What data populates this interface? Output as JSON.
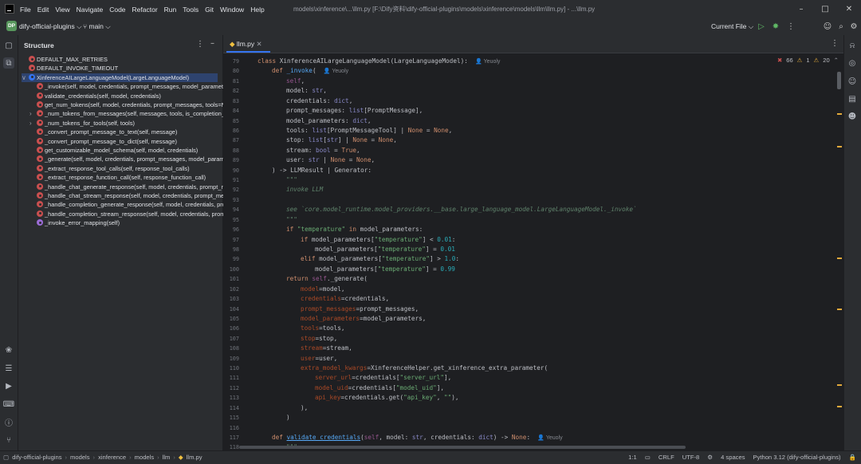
{
  "menu": [
    "File",
    "Edit",
    "View",
    "Navigate",
    "Code",
    "Refactor",
    "Run",
    "Tools",
    "Git",
    "Window",
    "Help"
  ],
  "window_title": "models\\xinference\\...\\llm.py [F:\\Dify资料\\dify-official-plugins\\models\\xinference\\models\\llm\\llm.py] - ...\\llm.py",
  "project": {
    "badge": "DP",
    "name": "dify-official-plugins",
    "branch": "main"
  },
  "run_config": "Current File",
  "structure": {
    "title": "Structure",
    "items": [
      {
        "label": "DEFAULT_MAX_RETRIES",
        "icon": "field-icon",
        "indent": 0
      },
      {
        "label": "DEFAULT_INVOKE_TIMEOUT",
        "icon": "field-icon",
        "indent": 0
      },
      {
        "label": "XinferenceAILargeLanguageModel(LargeLanguageModel)",
        "icon": "class-icon",
        "indent": 0,
        "selected": true,
        "expanded": true
      },
      {
        "label": "_invoke(self, model, credentials, prompt_messages, model_paramete",
        "icon": "method-icon",
        "indent": 1
      },
      {
        "label": "validate_credentials(self, model, credentials)",
        "icon": "method-icon",
        "indent": 1
      },
      {
        "label": "get_num_tokens(self, model, credentials, prompt_messages, tools=N",
        "icon": "method-icon",
        "indent": 1
      },
      {
        "label": "_num_tokens_from_messages(self, messages, tools, is_completion_m",
        "icon": "method-icon",
        "indent": 1,
        "collapsed": true
      },
      {
        "label": "_num_tokens_for_tools(self, tools)",
        "icon": "method-icon",
        "indent": 1,
        "collapsed": true
      },
      {
        "label": "_convert_prompt_message_to_text(self, message)",
        "icon": "method-icon",
        "indent": 1
      },
      {
        "label": "_convert_prompt_message_to_dict(self, message)",
        "icon": "method-icon",
        "indent": 1
      },
      {
        "label": "get_customizable_model_schema(self, model, credentials)",
        "icon": "method-icon",
        "indent": 1
      },
      {
        "label": "_generate(self, model, credentials, prompt_messages, model_param",
        "icon": "method-icon",
        "indent": 1
      },
      {
        "label": "_extract_response_tool_calls(self, response_tool_calls)",
        "icon": "method-icon",
        "indent": 1
      },
      {
        "label": "_extract_response_function_call(self, response_function_call)",
        "icon": "method-icon",
        "indent": 1
      },
      {
        "label": "_handle_chat_generate_response(self, model, credentials, prompt_m",
        "icon": "method-icon",
        "indent": 1
      },
      {
        "label": "_handle_chat_stream_response(self, model, credentials, prompt_mes",
        "icon": "method-icon",
        "indent": 1
      },
      {
        "label": "_handle_completion_generate_response(self, model, credentials, pro",
        "icon": "method-icon",
        "indent": 1
      },
      {
        "label": "_handle_completion_stream_response(self, model, credentials, prom",
        "icon": "method-icon",
        "indent": 1
      },
      {
        "label": "_invoke_error_mapping(self)",
        "icon": "property-icon",
        "indent": 1
      }
    ]
  },
  "editor": {
    "tab": "llm.py",
    "inspections": {
      "errors": "66",
      "warnings": "1",
      "weak": "20"
    },
    "hint_author": "Yeuoly",
    "lines": [
      {
        "n": "79",
        "html": "<span class='k'>class</span> XinferenceAILargeLanguageModel(LargeLanguageModel):  <span class='hint'>&#x1F464; Yeuoly</span>",
        "indent": 0
      },
      {
        "n": "80",
        "html": "<span class='k'>def</span> <span class='fn'>_invoke</span>(  <span class='hint'>&#x1F464; Yeuoly</span>",
        "indent": 1
      },
      {
        "n": "81",
        "html": "<span class='self'>self</span>,",
        "indent": 2
      },
      {
        "n": "82",
        "html": "model: <span class='bl'>str</span>,",
        "indent": 2
      },
      {
        "n": "83",
        "html": "credentials: <span class='bl'>dict</span>,",
        "indent": 2
      },
      {
        "n": "84",
        "html": "prompt_messages: <span class='bl'>list</span>[PromptMessage],",
        "indent": 2
      },
      {
        "n": "85",
        "html": "model_parameters: <span class='bl'>dict</span>,",
        "indent": 2
      },
      {
        "n": "86",
        "html": "tools: <span class='bl'>list</span>[PromptMessageTool] | <span class='k'>None</span> = <span class='k'>None</span>,",
        "indent": 2
      },
      {
        "n": "87",
        "html": "stop: <span class='bl'>list</span>[<span class='bl'>str</span>] | <span class='k'>None</span> = <span class='k'>None</span>,",
        "indent": 2
      },
      {
        "n": "88",
        "html": "stream: <span class='bl'>bool</span> = <span class='k'>True</span>,",
        "indent": 2
      },
      {
        "n": "89",
        "html": "user: <span class='bl'>str</span> | <span class='k'>None</span> = <span class='k'>None</span>,",
        "indent": 2
      },
      {
        "n": "90",
        "html": ") -&gt; LLMResult | Generator:",
        "indent": 1
      },
      {
        "n": "91",
        "html": "<span class='doc'>\"\"\"</span>",
        "indent": 2
      },
      {
        "n": "92",
        "html": "<span class='doc'>invoke LLM</span>",
        "indent": 2
      },
      {
        "n": "93",
        "html": "",
        "indent": 2
      },
      {
        "n": "94",
        "html": "<span class='doc'>see `core.model_runtime.model_providers.__base.large_language_model.LargeLanguageModel._invoke`</span>",
        "indent": 2
      },
      {
        "n": "95",
        "html": "<span class='doc'>\"\"\"</span>",
        "indent": 2
      },
      {
        "n": "96",
        "html": "<span class='k'>if</span> <span class='str'>\"temperature\"</span> <span class='k'>in</span> model_parameters:",
        "indent": 2
      },
      {
        "n": "97",
        "html": "<span class='k'>if</span> model_parameters[<span class='str'>\"temperature\"</span>] &lt; <span class='num'>0.01</span>:",
        "indent": 3
      },
      {
        "n": "98",
        "html": "model_parameters[<span class='str'>\"temperature\"</span>] = <span class='num'>0.01</span>",
        "indent": 4
      },
      {
        "n": "99",
        "html": "<span class='k'>elif</span> model_parameters[<span class='str'>\"temperature\"</span>] &gt; <span class='num'>1.0</span>:",
        "indent": 3
      },
      {
        "n": "100",
        "html": "model_parameters[<span class='str'>\"temperature\"</span>] = <span class='num'>0.99</span>",
        "indent": 4
      },
      {
        "n": "101",
        "html": "<span class='k'>return</span> <span class='self'>self</span>._generate(",
        "indent": 2
      },
      {
        "n": "102",
        "html": "<span class='kw'>model</span>=model,",
        "indent": 3
      },
      {
        "n": "103",
        "html": "<span class='kw'>credentials</span>=credentials,",
        "indent": 3
      },
      {
        "n": "104",
        "html": "<span class='kw'>prompt_messages</span>=prompt_messages,",
        "indent": 3
      },
      {
        "n": "105",
        "html": "<span class='kw'>model_parameters</span>=model_parameters,",
        "indent": 3
      },
      {
        "n": "106",
        "html": "<span class='kw'>tools</span>=tools,",
        "indent": 3
      },
      {
        "n": "107",
        "html": "<span class='kw'>stop</span>=stop,",
        "indent": 3
      },
      {
        "n": "108",
        "html": "<span class='kw'>stream</span>=stream,",
        "indent": 3
      },
      {
        "n": "109",
        "html": "<span class='kw'>user</span>=user,",
        "indent": 3
      },
      {
        "n": "110",
        "html": "<span class='kw'>extra_model_kwargs</span>=XinferenceHelper.get_xinference_extra_parameter(",
        "indent": 3
      },
      {
        "n": "111",
        "html": "<span class='kw'>server_url</span>=credentials[<span class='str'>\"server_url\"</span>],",
        "indent": 4
      },
      {
        "n": "112",
        "html": "<span class='kw'>model_uid</span>=credentials[<span class='str'>\"model_uid\"</span>],",
        "indent": 4
      },
      {
        "n": "113",
        "html": "<span class='kw'>api_key</span>=credentials.get(<span class='str'>\"api_key\"</span>, <span class='str'>\"\"</span>),",
        "indent": 4
      },
      {
        "n": "114",
        "html": "),",
        "indent": 3
      },
      {
        "n": "115",
        "html": ")",
        "indent": 2
      },
      {
        "n": "116",
        "html": "",
        "indent": 0
      },
      {
        "n": "117",
        "html": "<span class='k'>def</span> <span class='fn' style='text-decoration:underline'>validate_credentials</span>(<span class='self'>self</span>, model: <span class='bl'>str</span>, credentials: <span class='bl'>dict</span>) -&gt; <span class='k'>None</span>:  <span class='hint'>&#x1F464; Yeuoly</span>",
        "indent": 1
      },
      {
        "n": "118",
        "html": "<span class='doc'>\"\"\"</span>",
        "indent": 2
      }
    ]
  },
  "breadcrumbs": [
    "dify-official-plugins",
    "models",
    "xinference",
    "models",
    "llm",
    "llm.py"
  ],
  "status": {
    "position": "1:1",
    "line_sep": "CRLF",
    "encoding": "UTF-8",
    "indent": "4 spaces",
    "interpreter": "Python 3.12 (dify-official-plugins)"
  },
  "colors": {
    "accent": "#3574f0",
    "error": "#c94f4f",
    "warning": "#e2a93b",
    "ok": "#8bc34a"
  }
}
